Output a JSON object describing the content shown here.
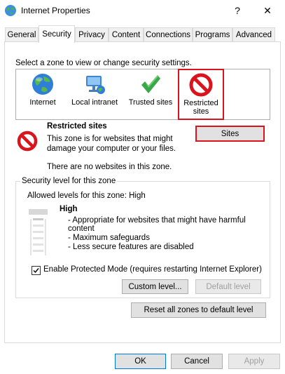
{
  "window": {
    "title": "Internet Properties",
    "help_glyph": "?",
    "close_glyph": "✕"
  },
  "tabs": [
    {
      "label": "General",
      "active": false
    },
    {
      "label": "Security",
      "active": true
    },
    {
      "label": "Privacy",
      "active": false
    },
    {
      "label": "Content",
      "active": false
    },
    {
      "label": "Connections",
      "active": false
    },
    {
      "label": "Programs",
      "active": false
    },
    {
      "label": "Advanced",
      "active": false
    }
  ],
  "security": {
    "zone_prompt": "Select a zone to view or change security settings.",
    "zones": [
      {
        "label": "Internet",
        "icon": "globe-icon",
        "selected": false
      },
      {
        "label": "Local intranet",
        "icon": "network-icon",
        "selected": false
      },
      {
        "label": "Trusted sites",
        "icon": "checkmark-icon",
        "selected": false
      },
      {
        "label": "Restricted\nsites",
        "icon": "restricted-icon",
        "selected": true
      }
    ],
    "zone_info": {
      "heading": "Restricted sites",
      "description_line1": "This zone is for websites that might",
      "description_line2": "damage your computer or your files.",
      "sites_note": "There are no websites in this zone.",
      "sites_button": "Sites"
    },
    "level_group": {
      "title": "Security level for this zone",
      "allowed": "Allowed levels for this zone: High",
      "level_name": "High",
      "bullets": [
        "- Appropriate for websites that might have harmful",
        "content",
        "- Maximum safeguards",
        "- Less secure features are disabled"
      ],
      "protected_mode_label": "Enable Protected Mode (requires restarting Internet Explorer)",
      "protected_mode_checked": true,
      "custom_level_button": "Custom level...",
      "default_level_button": "Default level"
    },
    "reset_button": "Reset all zones to default level"
  },
  "footer": {
    "ok": "OK",
    "cancel": "Cancel",
    "apply": "Apply"
  },
  "colors": {
    "highlight_red": "#d9141d",
    "accent_blue": "#0078d7"
  }
}
